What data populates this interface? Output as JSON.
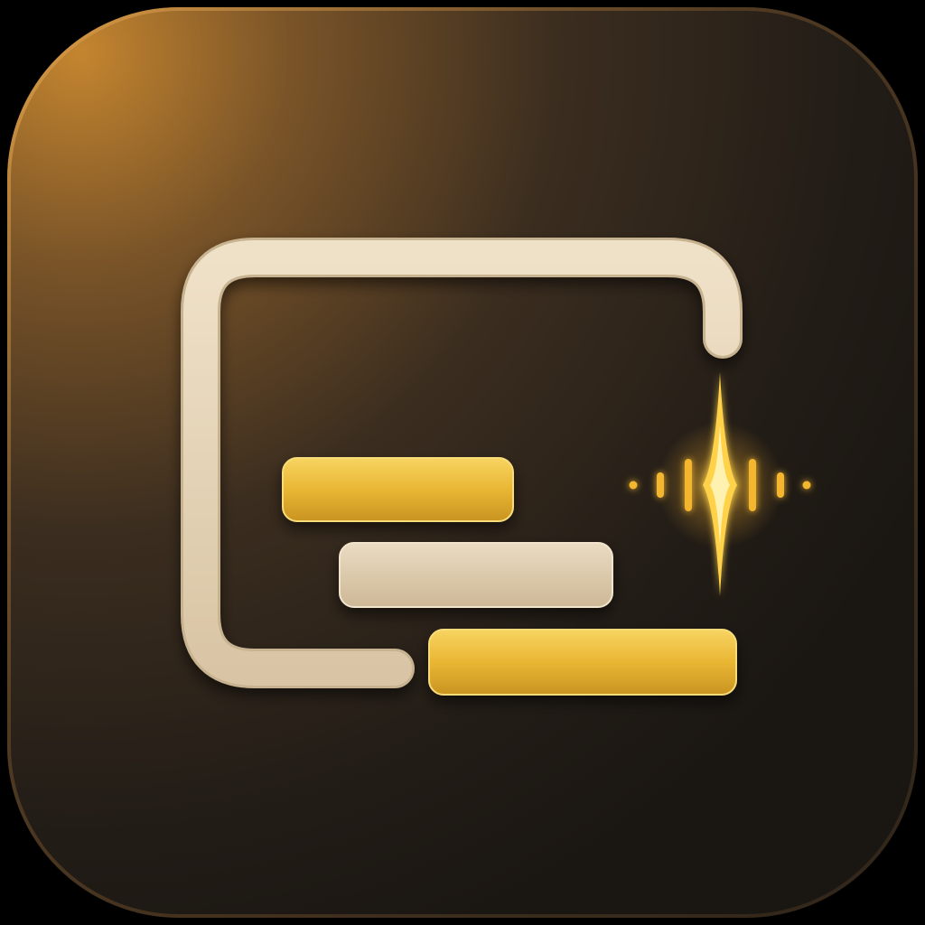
{
  "icon": {
    "name": "captions-transcript-app-icon",
    "glyph": "caption-frame-with-text-lines-and-audio-sparkle",
    "colors": {
      "background_light": "#b97a2f",
      "background_mid": "#4a3722",
      "background_dark": "#1d1814",
      "frame": "#e7d6bb",
      "frame_edge": "#c9b596",
      "gold": "#f2c240",
      "gold_dark": "#c9931d",
      "beige_bar": "#dccab0",
      "sparkle": "#ffd24a",
      "glow": "#ffb62e"
    }
  }
}
